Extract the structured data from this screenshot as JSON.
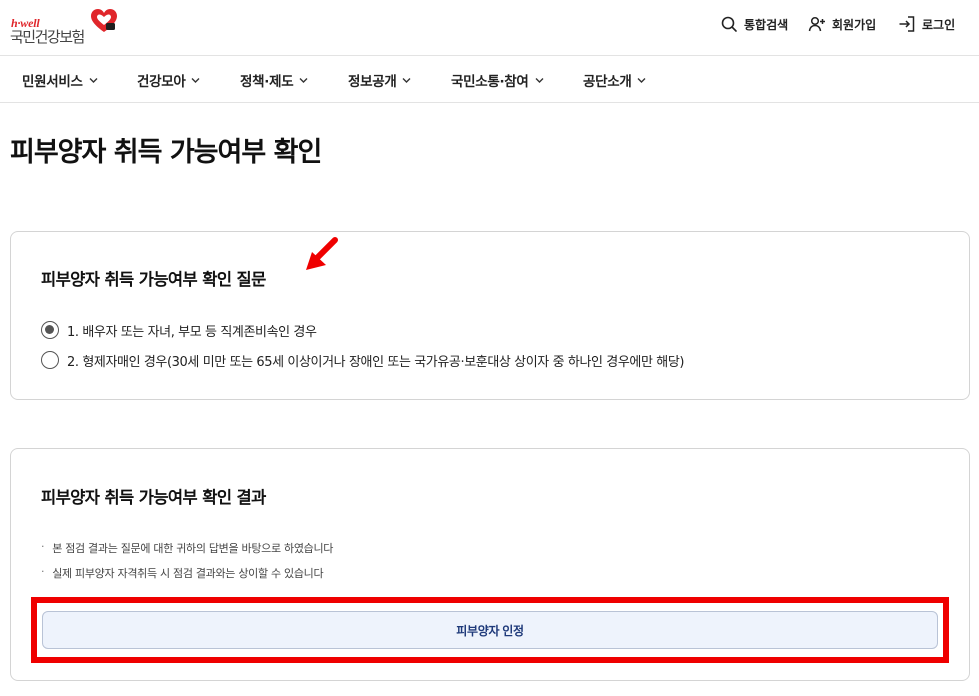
{
  "brand": {
    "tagline": "h·well",
    "name": "국민건강보험",
    "accent_color": "#e0262b"
  },
  "utility_nav": [
    {
      "label": "통합검색",
      "icon": "search-icon"
    },
    {
      "label": "회원가입",
      "icon": "user-plus-icon"
    },
    {
      "label": "로그인",
      "icon": "login-icon"
    }
  ],
  "main_nav": [
    {
      "label": "민원서비스",
      "icon": "chevron-down-icon"
    },
    {
      "label": "건강모아",
      "icon": "chevron-down-icon"
    },
    {
      "label": "정책·제도",
      "icon": "chevron-down-icon"
    },
    {
      "label": "정보공개",
      "icon": "chevron-down-icon"
    },
    {
      "label": "국민소통·참여",
      "icon": "chevron-down-icon"
    },
    {
      "label": "공단소개",
      "icon": "chevron-down-icon"
    }
  ],
  "page": {
    "title": "피부양자 취득 가능여부 확인"
  },
  "question_card": {
    "title": "피부양자 취득 가능여부 확인 질문",
    "selected_option": 1,
    "options": [
      {
        "label": "1. 배우자 또는 자녀, 부모 등 직계존비속인 경우",
        "checked": true
      },
      {
        "label": "2. 형제자매인 경우(30세 미만 또는 65세 이상이거나 장애인 또는 국가유공·보훈대상 상이자 중 하나인 경우에만 해당)",
        "checked": false
      }
    ]
  },
  "result_card": {
    "title": "피부양자 취득 가능여부 확인 결과",
    "notes": [
      "본 점검 결과는 질문에 대한 귀하의 답변을 바탕으로 하였습니다",
      "실제 피부양자 자격취득 시 점검 결과와는 상이할 수 있습니다"
    ],
    "result_button_label": "피부양자 인정"
  },
  "annotation_colors": {
    "highlight": "#ef0000"
  }
}
